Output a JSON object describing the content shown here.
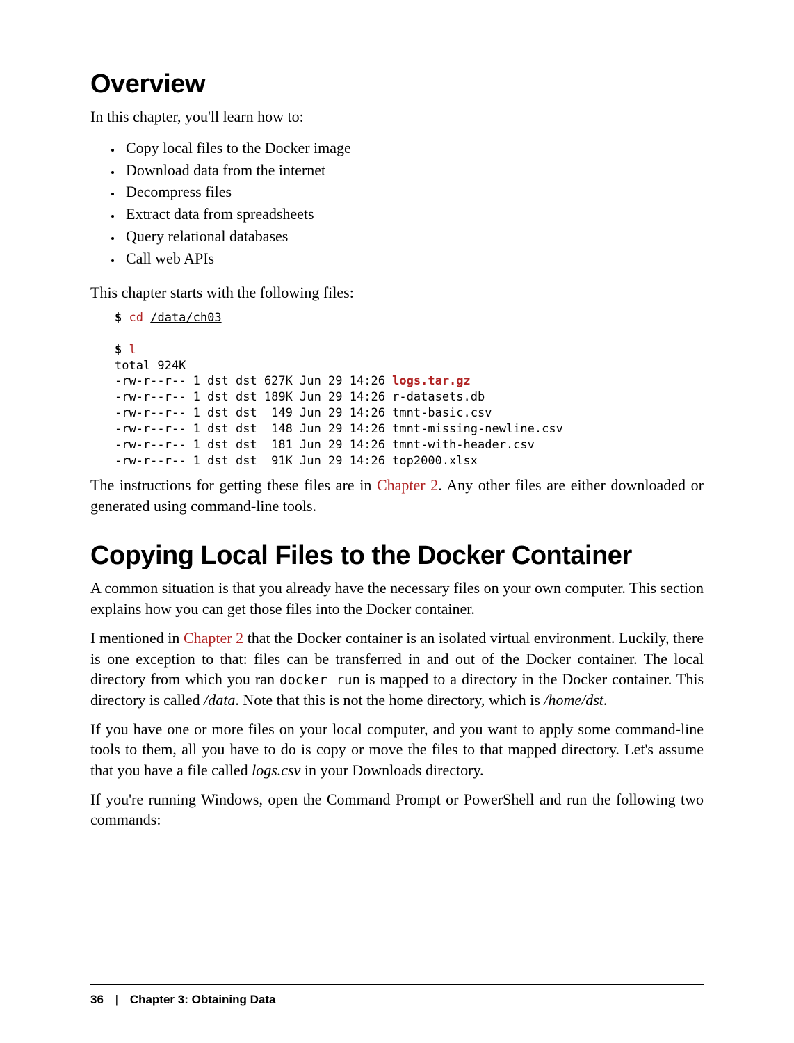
{
  "section1": {
    "heading": "Overview",
    "intro": "In this chapter, you'll learn how to:",
    "bullets": [
      "Copy local files to the Docker image",
      "Download data from the internet",
      "Decompress files",
      "Extract data from spreadsheets",
      "Query relational databases",
      "Call web APIs"
    ],
    "after_list": "This chapter starts with the following files:"
  },
  "code": {
    "prompt": "$",
    "cmd1": "cd",
    "arg1": "/data/ch03",
    "cmd2": "l",
    "total": "total 924K",
    "rows": [
      {
        "perm": "-rw-r--r-- 1 dst dst 627K Jun 29 14:26 ",
        "name": "logs.tar.gz",
        "hl": true
      },
      {
        "perm": "-rw-r--r-- 1 dst dst 189K Jun 29 14:26 ",
        "name": "r-datasets.db",
        "hl": false
      },
      {
        "perm": "-rw-r--r-- 1 dst dst  149 Jun 29 14:26 ",
        "name": "tmnt-basic.csv",
        "hl": false
      },
      {
        "perm": "-rw-r--r-- 1 dst dst  148 Jun 29 14:26 ",
        "name": "tmnt-missing-newline.csv",
        "hl": false
      },
      {
        "perm": "-rw-r--r-- 1 dst dst  181 Jun 29 14:26 ",
        "name": "tmnt-with-header.csv",
        "hl": false
      },
      {
        "perm": "-rw-r--r-- 1 dst dst  91K Jun 29 14:26 ",
        "name": "top2000.xlsx",
        "hl": false
      }
    ]
  },
  "para_after_code": {
    "pre": "The instructions for getting these files are in ",
    "link": "Chapter 2",
    "post": ". Any other files are either downloaded or generated using command-line tools."
  },
  "section2": {
    "heading": "Copying Local Files to the Docker Container",
    "p1": "A common situation is that you already have the necessary files on your own computer. This section explains how you can get those files into the Docker container.",
    "p2": {
      "pre": "I mentioned in ",
      "link": "Chapter 2",
      "mid1": " that the Docker container is an isolated virtual environment. Luckily, there is one exception to that: files can be transferred in and out of the Docker container. The local directory from which you ran ",
      "mono": "docker run",
      "mid2": " is mapped to a directory in the Docker container. This directory is called ",
      "it1": "/data",
      "mid3": ". Note that this is not the home directory, which is ",
      "it2": "/home/dst",
      "end": "."
    },
    "p3": {
      "pre": "If you have one or more files on your local computer, and you want to apply some command-line tools to them, all you have to do is copy or move the files to that mapped directory. Let's assume that you have a file called ",
      "it": "logs.csv",
      "post": " in your Downloads directory."
    },
    "p4": "If you're running Windows, open the Command Prompt or PowerShell and run the following two commands:"
  },
  "footer": {
    "page": "36",
    "sep": "|",
    "chapter": "Chapter 3: Obtaining Data"
  }
}
